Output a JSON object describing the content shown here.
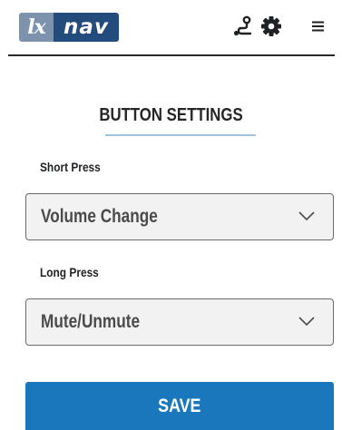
{
  "header": {
    "logo": {
      "part1": "lx",
      "part2": "nav"
    },
    "icons": [
      "route-icon",
      "gear-icon",
      "menu-icon"
    ]
  },
  "page": {
    "title": "BUTTON SETTINGS"
  },
  "fields": {
    "short_press": {
      "label": "Short Press",
      "value": "Volume Change"
    },
    "long_press": {
      "label": "Long Press",
      "value": "Mute/Unmute"
    }
  },
  "actions": {
    "save_label": "SAVE"
  },
  "colors": {
    "logo_light": "#7d93ad",
    "logo_dark": "#234c7c",
    "title_underline": "#9fc2dd",
    "save_button": "#1b77bb",
    "select_background": "#f2f2f2"
  }
}
